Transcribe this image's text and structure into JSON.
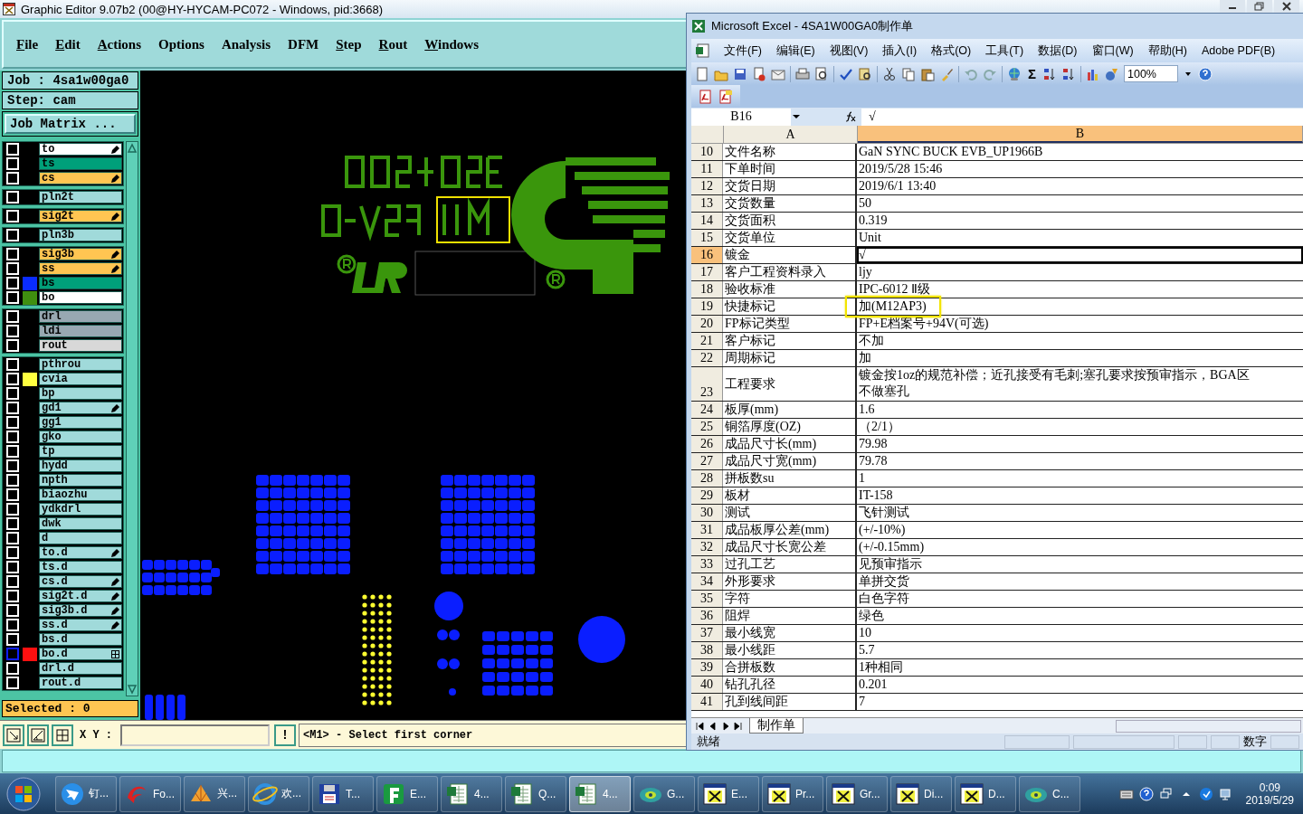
{
  "ge_window": {
    "title": "Graphic Editor 9.07b2 (00@HY-HYCAM-PC072 - Windows, pid:3668)",
    "menu": [
      {
        "label": "File",
        "mnemonic": true
      },
      {
        "label": "Edit",
        "mnemonic": true
      },
      {
        "label": "Actions",
        "mnemonic": true
      },
      {
        "label": "Options",
        "mnemonic": false
      },
      {
        "label": "Analysis",
        "mnemonic": false
      },
      {
        "label": "DFM",
        "mnemonic": false
      },
      {
        "label": "Step",
        "mnemonic": true
      },
      {
        "label": "Rout",
        "mnemonic": true
      },
      {
        "label": "Windows",
        "mnemonic": true
      }
    ],
    "job": "Job : 4sa1w00ga0",
    "step": "Step: cam",
    "job_matrix_button": "Job Matrix ...",
    "layer_groups": [
      {
        "layers": [
          {
            "name": "to",
            "kind": "silk",
            "affected": true,
            "checked": false,
            "focused": false
          },
          {
            "name": "ts",
            "kind": "mask",
            "affected": false,
            "checked": false,
            "focused": false
          },
          {
            "name": "cs",
            "kind": "signal",
            "affected": true,
            "checked": false,
            "focused": false
          }
        ]
      },
      {
        "layers": [
          {
            "name": "pln2t",
            "kind": "plane",
            "affected": false,
            "checked": false,
            "focused": false
          }
        ]
      },
      {
        "layers": [
          {
            "name": "sig2t",
            "kind": "signal",
            "affected": true,
            "checked": false,
            "focused": false
          }
        ]
      },
      {
        "layers": [
          {
            "name": "pln3b",
            "kind": "plane",
            "affected": false,
            "checked": false,
            "focused": false
          }
        ]
      },
      {
        "layers": [
          {
            "name": "sig3b",
            "kind": "signal",
            "affected": true,
            "checked": false,
            "focused": false
          },
          {
            "name": "ss",
            "kind": "signal",
            "affected": true,
            "checked": false,
            "focused": false
          },
          {
            "name": "bs",
            "kind": "mask",
            "color": "#0a2cff",
            "affected": false,
            "checked": false,
            "focused": false
          },
          {
            "name": "bo",
            "kind": "silk",
            "color": "#3f8f10",
            "affected": false,
            "checked": false,
            "focused": false
          }
        ]
      },
      {
        "layers": [
          {
            "name": "drl",
            "kind": "drill",
            "affected": false,
            "checked": false,
            "focused": false
          },
          {
            "name": "ldi",
            "kind": "drill",
            "affected": false,
            "checked": false,
            "focused": false
          },
          {
            "name": "rout",
            "kind": "rout",
            "affected": false,
            "checked": false,
            "focused": false
          }
        ]
      },
      {
        "layers": [
          {
            "name": "pthrou",
            "kind": "document",
            "affected": false,
            "checked": false,
            "focused": false
          },
          {
            "name": "cvia",
            "kind": "document",
            "color": "#ffff40",
            "affected": false,
            "checked": false,
            "focused": false
          },
          {
            "name": "bp",
            "kind": "document",
            "affected": false,
            "checked": false,
            "focused": false
          },
          {
            "name": "gd1",
            "kind": "document",
            "affected": true,
            "checked": false,
            "focused": false
          },
          {
            "name": "gg1",
            "kind": "document",
            "affected": false,
            "checked": false,
            "focused": false
          },
          {
            "name": "gko",
            "kind": "document",
            "affected": false,
            "checked": false,
            "focused": false
          },
          {
            "name": "tp",
            "kind": "document",
            "affected": false,
            "checked": false,
            "focused": false
          },
          {
            "name": "hydd",
            "kind": "document",
            "affected": false,
            "checked": false,
            "focused": false
          },
          {
            "name": "npth",
            "kind": "document",
            "affected": false,
            "checked": false,
            "focused": false
          },
          {
            "name": "biaozhu",
            "kind": "document",
            "affected": false,
            "checked": false,
            "focused": false
          },
          {
            "name": "ydkdrl",
            "kind": "document",
            "affected": false,
            "checked": false,
            "focused": false
          },
          {
            "name": "dwk",
            "kind": "document",
            "affected": false,
            "checked": false,
            "focused": false
          },
          {
            "name": "d",
            "kind": "document",
            "affected": false,
            "checked": false,
            "focused": false
          },
          {
            "name": "to.d",
            "kind": "document",
            "affected": true,
            "checked": false,
            "focused": false
          },
          {
            "name": "ts.d",
            "kind": "document",
            "affected": false,
            "checked": false,
            "focused": false
          },
          {
            "name": "cs.d",
            "kind": "document",
            "affected": true,
            "checked": false,
            "focused": false
          },
          {
            "name": "sig2t.d",
            "kind": "document",
            "affected": true,
            "checked": false,
            "focused": false
          },
          {
            "name": "sig3b.d",
            "kind": "document",
            "affected": true,
            "checked": false,
            "focused": false
          },
          {
            "name": "ss.d",
            "kind": "document",
            "affected": true,
            "checked": false,
            "focused": false
          },
          {
            "name": "bs.d",
            "kind": "document",
            "affected": false,
            "checked": false,
            "focused": false
          },
          {
            "name": "bo.d",
            "kind": "document",
            "color": "#ff1010",
            "affected": false,
            "checked": false,
            "focused": true
          },
          {
            "name": "drl.d",
            "kind": "document",
            "affected": false,
            "checked": false,
            "focused": false
          },
          {
            "name": "rout.d",
            "kind": "document",
            "affected": false,
            "checked": false,
            "focused": false
          }
        ]
      }
    ],
    "selected_count": "Selected : 0",
    "coords_label": "X Y :",
    "alert_button": "!",
    "message": "<M1> - Select first corner"
  },
  "excel_window": {
    "title": "Microsoft Excel - 4SA1W00GA0制作单",
    "menu": [
      "文件(F)",
      "编辑(E)",
      "视图(V)",
      "插入(I)",
      "格式(O)",
      "工具(T)",
      "数据(D)",
      "窗口(W)",
      "帮助(H)",
      "Adobe PDF(B)"
    ],
    "sum_button": "Σ",
    "zoom": "100%",
    "name_box": "B16",
    "formula": "√",
    "columns": [
      {
        "label": "A",
        "selected": false
      },
      {
        "label": "B",
        "selected": true
      }
    ],
    "rows": [
      {
        "num": "10",
        "a": "文件名称",
        "b": [
          "GaN SYNC BUCK EVB_UP1966B"
        ],
        "selected": false,
        "marked": false
      },
      {
        "num": "11",
        "a": "下单时间",
        "b": [
          "2019/5/28 15:46"
        ],
        "selected": false,
        "marked": false
      },
      {
        "num": "12",
        "a": "交货日期",
        "b": [
          "2019/6/1 13:40"
        ],
        "selected": false,
        "marked": false
      },
      {
        "num": "13",
        "a": "交货数量",
        "b": [
          "50"
        ],
        "selected": false,
        "marked": false
      },
      {
        "num": "14",
        "a": "交货面积",
        "b": [
          "0.319"
        ],
        "selected": false,
        "marked": false
      },
      {
        "num": "15",
        "a": "交货单位",
        "b": [
          "Unit"
        ],
        "selected": false,
        "marked": false
      },
      {
        "num": "16",
        "a": "镀金",
        "b": [
          "√"
        ],
        "selected": true,
        "marked": false
      },
      {
        "num": "17",
        "a": "客户工程资料录入",
        "b": [
          "ljy"
        ],
        "selected": false,
        "marked": false
      },
      {
        "num": "18",
        "a": "验收标准",
        "b": [
          "IPC-6012 Ⅱ级"
        ],
        "selected": false,
        "marked": false
      },
      {
        "num": "19",
        "a": "快捷标记",
        "b": [
          "加(M12AP3)"
        ],
        "selected": false,
        "marked": true
      },
      {
        "num": "20",
        "a": "FP标记类型",
        "b": [
          "FP+E档案号+94V(可选)"
        ],
        "selected": false,
        "marked": false
      },
      {
        "num": "21",
        "a": "客户标记",
        "b": [
          "不加"
        ],
        "selected": false,
        "marked": false
      },
      {
        "num": "22",
        "a": "周期标记",
        "b": [
          "加"
        ],
        "selected": false,
        "marked": false
      },
      {
        "num": "23",
        "a": "工程要求",
        "b": [
          "镀金按1oz的规范补偿；近孔接受有毛刺;塞孔要求按预审指示，BGA区",
          "不做塞孔"
        ],
        "selected": false,
        "marked": false
      },
      {
        "num": "24",
        "a": "板厚(mm)",
        "b": [
          "1.6"
        ],
        "selected": false,
        "marked": false
      },
      {
        "num": "25",
        "a": "铜箔厚度(OZ)",
        "b": [
          "（2/1）"
        ],
        "selected": false,
        "marked": false
      },
      {
        "num": "26",
        "a": "成品尺寸长(mm)",
        "b": [
          "79.98"
        ],
        "selected": false,
        "marked": false
      },
      {
        "num": "27",
        "a": "成品尺寸宽(mm)",
        "b": [
          "79.78"
        ],
        "selected": false,
        "marked": false
      },
      {
        "num": "28",
        "a": "拼板数su",
        "b": [
          "1"
        ],
        "selected": false,
        "marked": false
      },
      {
        "num": "29",
        "a": "板材",
        "b": [
          "IT-158"
        ],
        "selected": false,
        "marked": false
      },
      {
        "num": "30",
        "a": "测试",
        "b": [
          "飞针测试"
        ],
        "selected": false,
        "marked": false
      },
      {
        "num": "31",
        "a": "成品板厚公差(mm)",
        "b": [
          "(+/-10%)"
        ],
        "selected": false,
        "marked": false
      },
      {
        "num": "32",
        "a": "成品尺寸长宽公差",
        "b": [
          "(+/-0.15mm)"
        ],
        "selected": false,
        "marked": false
      },
      {
        "num": "33",
        "a": "过孔工艺",
        "b": [
          "见预审指示"
        ],
        "selected": false,
        "marked": false
      },
      {
        "num": "34",
        "a": "外形要求",
        "b": [
          "单拼交货"
        ],
        "selected": false,
        "marked": false
      },
      {
        "num": "35",
        "a": "字符",
        "b": [
          "白色字符"
        ],
        "selected": false,
        "marked": false
      },
      {
        "num": "36",
        "a": "阻焊",
        "b": [
          "绿色"
        ],
        "selected": false,
        "marked": false
      },
      {
        "num": "37",
        "a": "最小线宽",
        "b": [
          "10"
        ],
        "selected": false,
        "marked": false
      },
      {
        "num": "38",
        "a": "最小线距",
        "b": [
          "5.7"
        ],
        "selected": false,
        "marked": false
      },
      {
        "num": "39",
        "a": "合拼板数",
        "b": [
          "1种相同"
        ],
        "selected": false,
        "marked": false
      },
      {
        "num": "40",
        "a": "钻孔孔径",
        "b": [
          "0.201"
        ],
        "selected": false,
        "marked": false
      },
      {
        "num": "41",
        "a": "孔到线间距",
        "b": [
          "7"
        ],
        "selected": false,
        "marked": false
      }
    ],
    "sheet_tab": "制作单",
    "status": "就绪",
    "status_mode": "数字"
  },
  "taskbar": {
    "items": [
      {
        "label": "钉...",
        "kind": "bird",
        "selected": false
      },
      {
        "label": "Fo...",
        "kind": "swirl",
        "selected": false
      },
      {
        "label": "兴...",
        "kind": "shell",
        "selected": false
      },
      {
        "label": "欢...",
        "kind": "globe",
        "selected": false
      },
      {
        "label": "T...",
        "kind": "disk",
        "selected": false
      },
      {
        "label": "E...",
        "kind": "green",
        "selected": false
      },
      {
        "label": "4...",
        "kind": "sheet",
        "selected": false
      },
      {
        "label": "Q...",
        "kind": "sheet",
        "selected": false
      },
      {
        "label": "4...",
        "kind": "sheet",
        "selected": true
      },
      {
        "label": "G...",
        "kind": "disc",
        "selected": false
      },
      {
        "label": "E...",
        "kind": "xwin",
        "selected": false
      },
      {
        "label": "Pr...",
        "kind": "xwin",
        "selected": false
      },
      {
        "label": "Gr...",
        "kind": "xwin",
        "selected": false
      },
      {
        "label": "Di...",
        "kind": "xwin",
        "selected": false
      },
      {
        "label": "D...",
        "kind": "xwin",
        "selected": false
      },
      {
        "label": "C...",
        "kind": "disc",
        "selected": false
      }
    ],
    "time": "0:09",
    "date": "2019/5/29"
  }
}
